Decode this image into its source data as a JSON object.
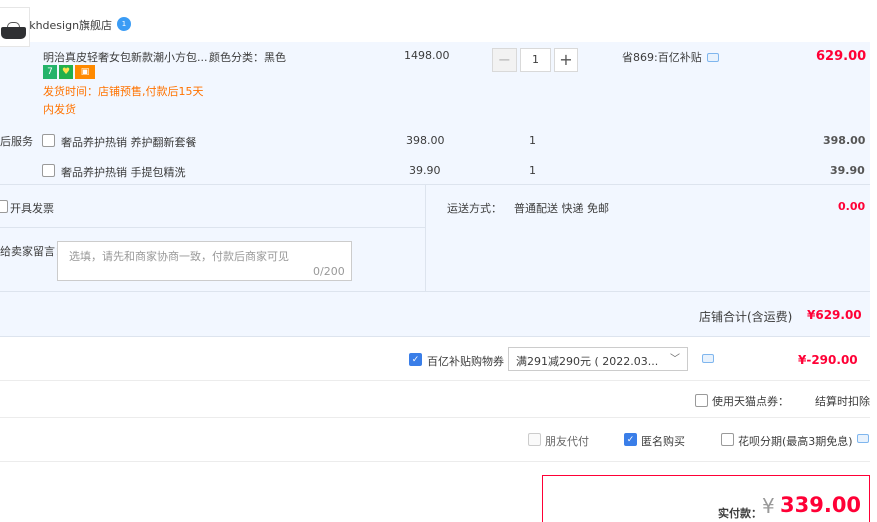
{
  "shop": {
    "label": "店铺: khdesign旗舰店",
    "badge": "1"
  },
  "item": {
    "title": "明治真皮轻奢女包新款潮小方包...",
    "sku": "颜色分类：黑色",
    "badges": {
      "seven": "7",
      "bulb": "♥",
      "card": "▣"
    },
    "ship_line1": "发货时间：店铺预售,付款后15天",
    "ship_line2": "内发货",
    "price": "1498.00",
    "qty": "1",
    "minus": "−",
    "plus": "+",
    "discount": "省869:百亿补贴",
    "subtotal": "629.00"
  },
  "services": {
    "label": "后服务",
    "rows": [
      {
        "name": "奢品养护热销 养护翻新套餐",
        "price": "398.00",
        "qty": "1",
        "total": "398.00"
      },
      {
        "name": "奢品养护热销 手提包精洗",
        "price": "39.90",
        "qty": "1",
        "total": "39.90"
      }
    ]
  },
  "invoice": {
    "label": "开具发票"
  },
  "message": {
    "label": "给卖家留言：",
    "placeholder": "选填，请先和商家协商一致，付款后商家可见",
    "count": "0/200"
  },
  "shipping": {
    "label": "运送方式：",
    "method": "普通配送 快递 免邮",
    "fee": "0.00"
  },
  "shop_total": {
    "label": "店铺合计(含运费)",
    "value": "¥629.00"
  },
  "coupon": {
    "label": "百亿补贴购物券",
    "value": "满291减290元 ( 2022.03...",
    "chevron": "﹀",
    "amount": "¥-290.00"
  },
  "points": {
    "label": "使用天猫点券：",
    "deduct": "结算时扣除"
  },
  "options": {
    "friend": "朋友代付",
    "anonymous": "匿名购买",
    "huabei": "花呗分期(最高3期免息)"
  },
  "pay": {
    "label": "实付款：",
    "yen": "¥",
    "amount": "339.00"
  },
  "colors": {
    "accent": "#ff0036",
    "panel": "#f2f7ff",
    "checkbox": "#3a7ee8",
    "warning": "#ff7300"
  }
}
